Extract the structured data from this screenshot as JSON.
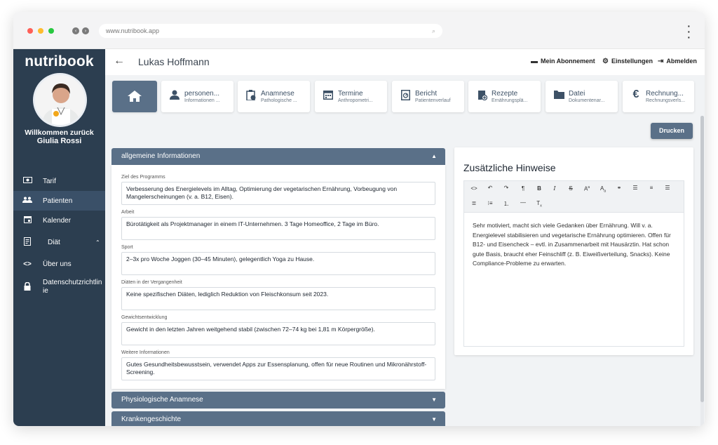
{
  "browser": {
    "url": "www.nutribook.app",
    "traffic_colors": [
      "#ff5f57",
      "#febc2e",
      "#28c840"
    ]
  },
  "sidebar": {
    "logo": "nutribook",
    "welcome": "Willkommen zurück",
    "username": "Giulia Rossi",
    "items": [
      {
        "label": "Tarif",
        "icon": "money-icon"
      },
      {
        "label": "Patienten",
        "icon": "people-icon"
      },
      {
        "label": "Kalender",
        "icon": "calendar-icon"
      },
      {
        "label": "Diät",
        "icon": "diet-icon"
      },
      {
        "label": "Über uns",
        "icon": "code-icon"
      },
      {
        "label": "Datenschutzrichtlinie",
        "icon": "lock-icon"
      }
    ]
  },
  "header": {
    "patient_name": "Lukas Hoffmann",
    "subscription": "Mein Abonnement",
    "settings": "Einstellungen",
    "logout": "Abmelden"
  },
  "tabs": [
    {
      "title": "personen...",
      "subtitle": "Informationen ..."
    },
    {
      "title": "Anamnese",
      "subtitle": "Pathologische ..."
    },
    {
      "title": "Termine",
      "subtitle": "Anthropometri..."
    },
    {
      "title": "Bericht",
      "subtitle": "Patientenverlauf"
    },
    {
      "title": "Rezepte",
      "subtitle": "Ernährungsplä..."
    },
    {
      "title": "Datei",
      "subtitle": "Dokumentenar..."
    },
    {
      "title": "Rechnung...",
      "subtitle": "Rechnungsverls..."
    }
  ],
  "print_label": "Drucken",
  "general_info": {
    "header": "allgemeine Informationen",
    "fields": [
      {
        "label": "Ziel des Programms",
        "value": "Verbesserung des Energielevels im Alltag, Optimierung der vegetarischen Ernährung, Vorbeugung von Mangelerscheinungen (v. a. B12, Eisen)."
      },
      {
        "label": "Arbeit",
        "value": "Bürotätigkeit als Projektmanager in einem IT-Unternehmen. 3 Tage Homeoffice, 2 Tage im Büro."
      },
      {
        "label": "Sport",
        "value": "2–3x pro Woche Joggen (30–45 Minuten), gelegentlich Yoga zu Hause."
      },
      {
        "label": "Diäten in der Vergangenheit",
        "value": "Keine spezifischen Diäten, lediglich Reduktion von Fleischkonsum seit 2023."
      },
      {
        "label": "Gewichtsentwicklung",
        "value": "Gewicht in den letzten Jahren weitgehend stabil (zwischen 72–74 kg bei 1,81 m Körpergröße)."
      },
      {
        "label": "Weitere Informationen",
        "value": "Gutes Gesundheitsbewusstsein, verwendet Apps zur Essensplanung, offen für neue Routinen und Mikronährstoff-Screening."
      }
    ]
  },
  "sections": {
    "physiological": "Physiologische Anamnese",
    "medical_history": "Krankengeschichte"
  },
  "notes": {
    "title": "Zusätzliche Hinweise",
    "text": "Sehr motiviert, macht sich viele Gedanken über Ernährung. Will v. a. Energielevel stabilisieren und vegetarische Ernährung optimieren. Offen für B12- und Eisencheck – evtl. in Zusammenarbeit mit Hausärztin. Hat schon gute Basis, braucht eher Feinschliff (z. B. Eiweißverteilung, Snacks). Keine Compliance-Probleme zu erwarten."
  },
  "colors": {
    "sidebar": "#2c3e50",
    "accent": "#5a7088"
  }
}
